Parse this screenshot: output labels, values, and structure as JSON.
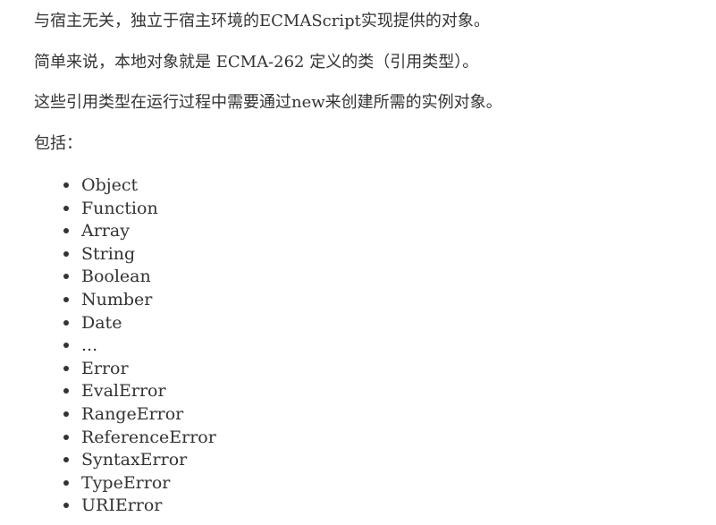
{
  "paragraphs": [
    "与宿主无关，独立于宿主环境的ECMAScript实现提供的对象。",
    "简单来说，本地对象就是 ECMA-262 定义的类（引用类型）。",
    "这些引用类型在运行过程中需要通过new来创建所需的实例对象。",
    "包括："
  ],
  "items": [
    "Object",
    "Function",
    "Array",
    "String",
    "Boolean",
    "Number",
    "Date",
    "...",
    "Error",
    "EvalError",
    "RangeError",
    "ReferenceError",
    "SyntaxError",
    "TypeError",
    "URIError"
  ]
}
